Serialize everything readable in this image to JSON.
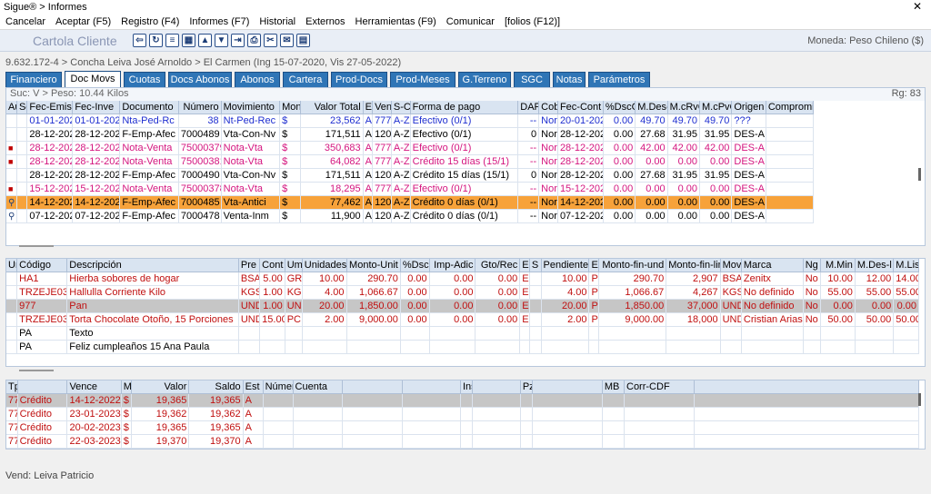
{
  "window": {
    "title": "Sigue® > Informes",
    "close": "✕"
  },
  "menu": [
    "Cancelar",
    "Aceptar (F5)",
    "Registro (F4)",
    "Informes (F7)",
    "Historial",
    "Externos",
    "Herramientas (F9)",
    "Comunicar",
    "[folios (F12)]"
  ],
  "toolbar": {
    "title": "Cartola Cliente",
    "moneda": "Moneda: Peso Chileno ($)",
    "icons": [
      "back-icon",
      "refresh-icon",
      "list-icon",
      "grid-icon",
      "up-icon",
      "down-icon",
      "export-icon",
      "print-icon",
      "tools-icon",
      "chat-icon",
      "calculator-icon"
    ]
  },
  "path": "9.632.172-4 > Concha Leiva José Arnoldo > El Carmen  (Ing 15-07-2020, Vis 27-05-2022)",
  "tabs": [
    "Financiero",
    "Doc Movs",
    "Cuotas",
    "Docs Abonos",
    "Abonos",
    "Cartera",
    "Prod-Docs",
    "Prod-Meses",
    "G.Terreno",
    "SGC",
    "Notas",
    "Parámetros"
  ],
  "active_tab": "Doc Movs",
  "info": {
    "suc": "Suc: V",
    "peso": "> Peso: 10.44 Kilos",
    "rg": "Rg: 83"
  },
  "docs": {
    "headers": [
      "Au",
      "Se",
      "Fec-Emis",
      "Fec-Inve",
      "Documento",
      "Número",
      "Movimiento",
      "Mon",
      "Valor Total",
      "E",
      "Ven",
      "S-C",
      "Forma de pago",
      "DAP",
      "Cob",
      "Fec-Cont",
      "%DscG",
      "M.Des-l",
      "M.cRvC",
      "M.cPvC",
      "Origen",
      "Compromiso"
    ],
    "rows": [
      {
        "style": "blue",
        "au": "",
        "cells": [
          "",
          "",
          "01-01-2023",
          "01-01-2023",
          "Nta-Ped-Rc",
          "38",
          "Nt-Ped-Rec",
          "$",
          "23,562",
          "A",
          "777",
          "A-Z",
          "Efectivo (0/1)",
          "--",
          "Nor",
          "20-01-2023",
          "0.00",
          "49.70",
          "49.70",
          "49.70",
          "???",
          ""
        ]
      },
      {
        "style": "",
        "au": "",
        "cells": [
          "",
          "",
          "28-12-2022",
          "28-12-2022",
          "F-Emp-Afec",
          "7000489",
          "Vta-Con-Nv",
          "$",
          "171,511",
          "A",
          "120",
          "A-Z",
          "Efectivo (0/1)",
          "0",
          "Nor",
          "28-12-2022",
          "0.00",
          "27.68",
          "31.95",
          "31.95",
          "DES-A",
          ""
        ]
      },
      {
        "style": "mag",
        "au": "lock",
        "cells": [
          "",
          "",
          "28-12-2022",
          "28-12-2022",
          "Nota-Venta",
          "75000379",
          "Nota-Vta",
          "$",
          "350,683",
          "A",
          "777",
          "A-Z",
          "Efectivo (0/1)",
          "--",
          "Nor",
          "28-12-2022",
          "0.00",
          "42.00",
          "42.00",
          "42.00",
          "DES-A",
          ""
        ]
      },
      {
        "style": "mag",
        "au": "lock",
        "cells": [
          "",
          "",
          "28-12-2022",
          "28-12-2022",
          "Nota-Venta",
          "75000381",
          "Nota-Vta",
          "$",
          "64,082",
          "A",
          "777",
          "A-Z",
          "Crédito 15 días (15/1)",
          "--",
          "Nor",
          "28-12-2022",
          "0.00",
          "0.00",
          "0.00",
          "0.00",
          "DES-A",
          ""
        ]
      },
      {
        "style": "",
        "au": "",
        "cells": [
          "",
          "",
          "28-12-2022",
          "28-12-2022",
          "F-Emp-Afec",
          "7000490",
          "Vta-Con-Nv",
          "$",
          "171,511",
          "A",
          "120",
          "A-Z",
          "Crédito 15 días (15/1)",
          "0",
          "Nor",
          "28-12-2022",
          "0.00",
          "27.68",
          "31.95",
          "31.95",
          "DES-A",
          ""
        ]
      },
      {
        "style": "mag",
        "au": "lock",
        "cells": [
          "",
          "",
          "15-12-2022",
          "15-12-2022",
          "Nota-Venta",
          "75000378",
          "Nota-Vta",
          "$",
          "18,295",
          "A",
          "777",
          "A-Z",
          "Efectivo (0/1)",
          "--",
          "Nor",
          "15-12-2022",
          "0.00",
          "0.00",
          "0.00",
          "0.00",
          "DES-A",
          ""
        ]
      },
      {
        "style": "sel",
        "au": "key",
        "cells": [
          "",
          "",
          "14-12-2022",
          "14-12-2022",
          "F-Emp-Afec",
          "7000485",
          "Vta-Antici",
          "$",
          "77,462",
          "A",
          "120",
          "A-Z",
          "Crédito 0 días (0/1)",
          "--",
          "Nor",
          "14-12-2022",
          "0.00",
          "0.00",
          "0.00",
          "0.00",
          "DES-A",
          ""
        ]
      },
      {
        "style": "",
        "au": "key",
        "cells": [
          "",
          "",
          "07-12-2022",
          "07-12-2022",
          "F-Emp-Afec",
          "7000478",
          "Venta-Inm",
          "$",
          "11,900",
          "A",
          "120",
          "A-Z",
          "Crédito 0 días (0/1)",
          "--",
          "Nor",
          "07-12-2022",
          "0.00",
          "0.00",
          "0.00",
          "0.00",
          "DES-A",
          ""
        ]
      }
    ]
  },
  "items": {
    "headers": [
      "Un",
      "Código",
      "Descripción",
      "Pre",
      "Cont",
      "Um",
      "Unidades",
      "Monto-Unit",
      "%Dsc",
      "Imp-Adic",
      "Gto/Rec",
      "E",
      "S",
      "Pendiente",
      "E",
      "Monto-fin-und",
      "Monto-fin-lin",
      "Mov",
      "Marca",
      "Ng",
      "M.Min",
      "M.Des-l",
      "M.Lis"
    ],
    "rows": [
      {
        "style": "red",
        "cells": [
          "",
          "HA1",
          "Hierba sobores de hogar",
          "BSA",
          "5.00",
          "GR",
          "10.00",
          "290.70",
          "0.00",
          "0.00",
          "0.00",
          "E",
          "",
          "10.00",
          "P",
          "290.70",
          "2,907",
          "BSA",
          "Zenitx",
          "No",
          "10.00",
          "12.00",
          "14.00"
        ]
      },
      {
        "style": "red",
        "cells": [
          "",
          "TRZEJE03",
          "Hallulla Corriente Kilo",
          "KGS",
          "1.00",
          "KG",
          "4.00",
          "1,066.67",
          "0.00",
          "0.00",
          "0.00",
          "E",
          "",
          "4.00",
          "P",
          "1,066.67",
          "4,267",
          "KGS",
          "No definido",
          "No",
          "55.00",
          "55.00",
          "55.00"
        ]
      },
      {
        "style": "gray red",
        "cells": [
          "",
          "977",
          "Pan",
          "UND",
          "1.00",
          "UN",
          "20.00",
          "1,850.00",
          "0.00",
          "0.00",
          "0.00",
          "E",
          "",
          "20.00",
          "P",
          "1,850.00",
          "37,000",
          "UND",
          "No definido",
          "No",
          "0.00",
          "0.00",
          "0.00"
        ]
      },
      {
        "style": "red",
        "cells": [
          "",
          "TRZEJE03",
          "Torta Chocolate Otoño, 15 Porciones",
          "UND",
          "15.00",
          "PC",
          "2.00",
          "9,000.00",
          "0.00",
          "0.00",
          "0.00",
          "E",
          "",
          "2.00",
          "P",
          "9,000.00",
          "18,000",
          "UND",
          "Cristian Arias",
          "No",
          "50.00",
          "50.00",
          "50.00"
        ]
      },
      {
        "style": "",
        "cells": [
          "",
          "PA",
          "Texto",
          "",
          "",
          "",
          "",
          "",
          "",
          "",
          "",
          "",
          "",
          "",
          "",
          "",
          "",
          "",
          "",
          "",
          "",
          "",
          ""
        ]
      },
      {
        "style": "",
        "cells": [
          "",
          "PA",
          "Feliz cumpleaños 15 Ana Paula",
          "",
          "",
          "",
          "",
          "",
          "",
          "",
          "",
          "",
          "",
          "",
          "",
          "",
          "",
          "",
          "",
          "",
          "",
          "",
          ""
        ]
      }
    ]
  },
  "cuotas": {
    "headers": [
      "Tp",
      "Vence",
      "M",
      "Valor",
      "Saldo",
      "Est",
      "Número",
      "Cuenta",
      "",
      "",
      "Ins",
      "",
      "Pza",
      "",
      "",
      "MB",
      "Corr-CDF"
    ],
    "rows": [
      {
        "style": "gray red",
        "cells": [
          "77",
          "Crédito",
          "14-12-2022",
          "$",
          "19,365",
          "19,365",
          "A",
          "",
          "",
          "",
          "",
          "",
          "",
          "",
          "",
          "",
          "",
          ""
        ]
      },
      {
        "style": "red",
        "cells": [
          "77",
          "Crédito",
          "23-01-2023",
          "$",
          "19,362",
          "19,362",
          "A",
          "",
          "",
          "",
          "",
          "",
          "",
          "",
          "",
          "",
          "",
          ""
        ]
      },
      {
        "style": "red",
        "cells": [
          "77",
          "Crédito",
          "20-02-2023",
          "$",
          "19,365",
          "19,365",
          "A",
          "",
          "",
          "",
          "",
          "",
          "",
          "",
          "",
          "",
          "",
          ""
        ]
      },
      {
        "style": "red",
        "cells": [
          "77",
          "Crédito",
          "22-03-2023",
          "$",
          "19,370",
          "19,370",
          "A",
          "",
          "",
          "",
          "",
          "",
          "",
          "",
          "",
          "",
          "",
          ""
        ]
      }
    ]
  },
  "status": "Vend: Leiva Patricio"
}
